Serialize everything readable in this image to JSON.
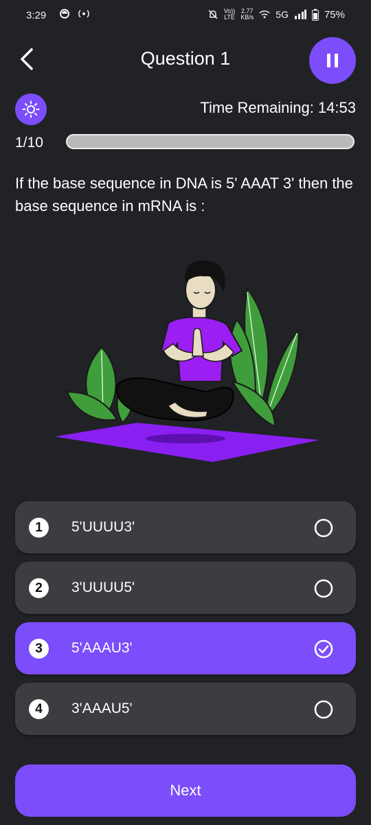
{
  "status_bar": {
    "time": "3:29",
    "net_speed_value": "2.77",
    "net_speed_unit": "KB/s",
    "network": "5G",
    "battery": "75%",
    "volte_top": "Vo))",
    "volte_bottom": "LTE"
  },
  "header": {
    "title": "Question 1"
  },
  "timer": {
    "text": "Time Remaining: 14:53"
  },
  "progress": {
    "counter": "1/10",
    "fraction": 0.0
  },
  "question": {
    "text": "If the base sequence in DNA is 5' AAAT 3' then the base sequence in mRNA is :"
  },
  "options": [
    {
      "number": "1",
      "text": "5'UUUU3'",
      "selected": false
    },
    {
      "number": "2",
      "text": "3'UUUU5'",
      "selected": false
    },
    {
      "number": "3",
      "text": "5'AAAU3'",
      "selected": true
    },
    {
      "number": "4",
      "text": "3'AAAU5'",
      "selected": false
    }
  ],
  "footer": {
    "next_label": "Next"
  },
  "colors": {
    "accent": "#7b4dfb",
    "background": "#212226",
    "option_bg": "#3d3d41"
  },
  "icons": [
    "back-chevron-icon",
    "pause-icon",
    "sun-icon",
    "radio-empty-icon",
    "check-circle-icon"
  ]
}
